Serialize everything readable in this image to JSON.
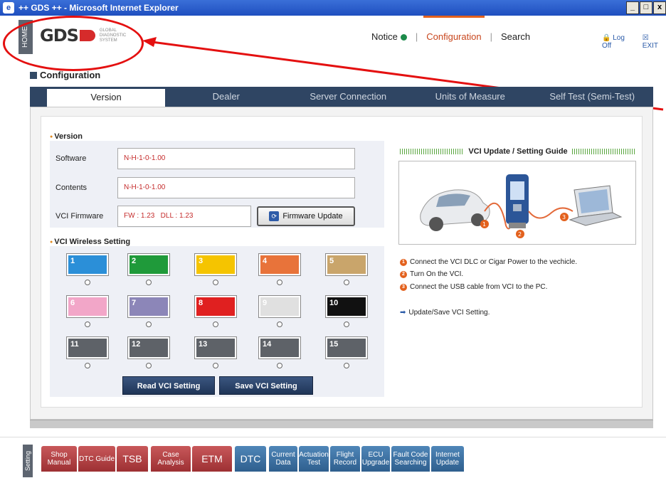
{
  "window": {
    "title": "++ GDS ++ - Microsoft Internet Explorer",
    "controls": [
      "_",
      "□",
      "x"
    ]
  },
  "header": {
    "home_label": "HOME",
    "logo_text": "GDS",
    "logo_sub": "GLOBAL DIAGNOSTIC SYSTEM",
    "nav": [
      "Notice",
      "Configuration",
      "Search"
    ],
    "active_nav": "Configuration",
    "logoff": "Log Off",
    "exit": "EXIT"
  },
  "page": {
    "title": "Configuration",
    "tabs": [
      "Version",
      "Dealer",
      "Server Connection",
      "Units of Measure",
      "Self Test (Semi-Test)"
    ],
    "active_tab": "Version"
  },
  "version": {
    "section": "Version",
    "software_label": "Software",
    "software_value": "N-H-1-0-1.00",
    "contents_label": "Contents",
    "contents_value": "N-H-1-0-1.00",
    "firmware_label": "VCI Firmware",
    "firmware_value": "FW : 1.23   DLL : 1.23",
    "firmware_button": "Firmware Update"
  },
  "wireless": {
    "section": "VCI Wireless Setting",
    "swatches": [
      {
        "label": "1",
        "color": "#2b8fd8"
      },
      {
        "label": "2",
        "color": "#1f9a3a"
      },
      {
        "label": "3",
        "color": "#f5c400"
      },
      {
        "label": "4",
        "color": "#e8733a"
      },
      {
        "label": "5",
        "color": "#c9a56b"
      },
      {
        "label": "6",
        "color": "#f2a6c8"
      },
      {
        "label": "7",
        "color": "#8c86b8"
      },
      {
        "label": "8",
        "color": "#e02020"
      },
      {
        "label": "9",
        "color": "#e0e0e0"
      },
      {
        "label": "10",
        "color": "#111111"
      },
      {
        "label": "11",
        "color": "#5e6268"
      },
      {
        "label": "12",
        "color": "#5e6268"
      },
      {
        "label": "13",
        "color": "#5e6268"
      },
      {
        "label": "14",
        "color": "#5e6268"
      },
      {
        "label": "15",
        "color": "#5e6268"
      }
    ],
    "read_button": "Read VCI Setting",
    "save_button": "Save VCI Setting"
  },
  "guide": {
    "title": "VCI Update / Setting Guide",
    "steps": [
      "Connect the VCI DLC or Cigar Power to the vechicle.",
      "Turn On the VCI.",
      "Connect the USB cable from VCI to the PC."
    ],
    "note": "Update/Save VCI Setting."
  },
  "bottom": {
    "setting_label": "Setting",
    "buttons": [
      {
        "label": "Shop Manual",
        "color": "red"
      },
      {
        "label": "DTC Guide",
        "color": "red"
      },
      {
        "label": "TSB",
        "color": "red"
      },
      {
        "label": "Case Analysis",
        "color": "red"
      },
      {
        "label": "ETM",
        "color": "red"
      },
      {
        "label": "DTC",
        "color": "blue"
      },
      {
        "label": "Current Data",
        "color": "blue"
      },
      {
        "label": "Actuation Test",
        "color": "blue"
      },
      {
        "label": "Flight Record",
        "color": "blue"
      },
      {
        "label": "ECU Upgrade",
        "color": "blue"
      },
      {
        "label": "Fault Code Searching",
        "color": "blue"
      },
      {
        "label": "Internet Update",
        "color": "blue"
      }
    ]
  }
}
